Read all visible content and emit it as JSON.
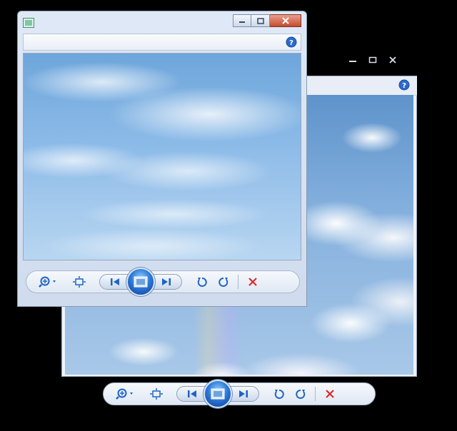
{
  "back_window": {
    "controls": [
      "minimize",
      "maximize",
      "close"
    ],
    "help_icon": "help-icon"
  },
  "front_window": {
    "app_icon": "photo-viewer-icon",
    "controls": [
      "minimize",
      "maximize",
      "close"
    ],
    "help_icon": "help-icon"
  },
  "control_bar": {
    "buttons": [
      "zoom",
      "fit-to-window",
      "previous",
      "slideshow",
      "next",
      "rotate-counterclockwise",
      "rotate-clockwise",
      "delete"
    ]
  },
  "colors": {
    "accent_blue": "#1f63c6",
    "delete_red": "#d92a2a",
    "close_red": "#c64a2e"
  }
}
